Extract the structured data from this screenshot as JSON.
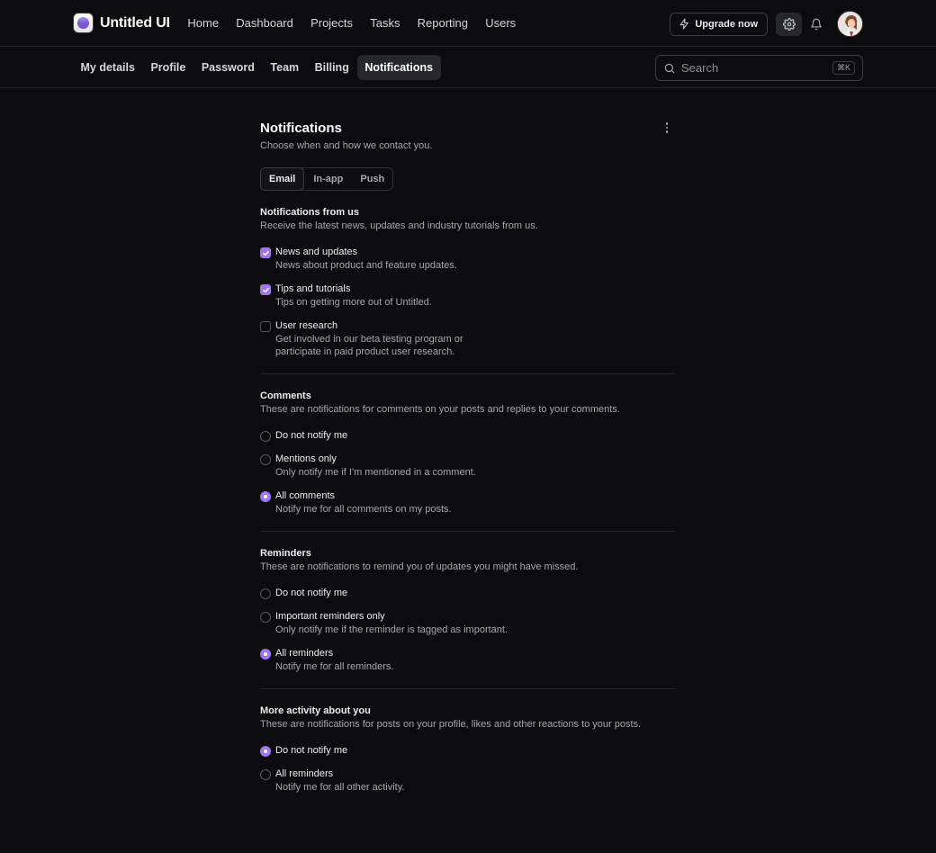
{
  "brand": {
    "name": "Untitled UI"
  },
  "main_nav": [
    "Home",
    "Dashboard",
    "Projects",
    "Tasks",
    "Reporting",
    "Users"
  ],
  "top_actions": {
    "upgrade_label": "Upgrade now",
    "upgrade_icon": "lightning-icon",
    "settings_icon": "gear-icon",
    "notifications_icon": "bell-icon"
  },
  "sub_nav": {
    "items": [
      "My details",
      "Profile",
      "Password",
      "Team",
      "Billing",
      "Notifications"
    ],
    "active": "Notifications"
  },
  "search": {
    "placeholder": "Search",
    "shortcut": "⌘K"
  },
  "page": {
    "title": "Notifications",
    "subtitle": "Choose when and how we contact you."
  },
  "tabs": {
    "items": [
      "Email",
      "In-app",
      "Push"
    ],
    "active": "Email"
  },
  "sections": {
    "from_us": {
      "title": "Notifications from us",
      "desc": "Receive the latest news, updates and industry tutorials from us.",
      "options": [
        {
          "label": "News and updates",
          "help": "News about product and feature updates.",
          "checked": true
        },
        {
          "label": "Tips and tutorials",
          "help": "Tips on getting more out of Untitled.",
          "checked": true
        },
        {
          "label": "User research",
          "help": "Get involved in our beta testing program or",
          "help2": "participate in paid product user research.",
          "checked": false
        }
      ]
    },
    "comments": {
      "title": "Comments",
      "desc": "These are notifications for comments on your posts and replies to your comments.",
      "options": [
        {
          "label": "Do not notify me",
          "help": "",
          "selected": false
        },
        {
          "label": "Mentions only",
          "help": "Only notify me if I'm mentioned in a comment.",
          "selected": false
        },
        {
          "label": "All comments",
          "help": "Notify me for all comments on my posts.",
          "selected": true
        }
      ]
    },
    "reminders": {
      "title": "Reminders",
      "desc": "These are notifications to remind you of updates you might have missed.",
      "options": [
        {
          "label": "Do not notify me",
          "help": "",
          "selected": false
        },
        {
          "label": "Important reminders only",
          "help": "Only notify me if the reminder is tagged as important.",
          "selected": false
        },
        {
          "label": "All reminders",
          "help": "Notify me for all reminders.",
          "selected": true
        }
      ]
    },
    "activity": {
      "title": "More activity about you",
      "desc": "These are notifications for posts on your profile, likes and other reactions to your posts.",
      "options": [
        {
          "label": "Do not notify me",
          "help": "",
          "selected": true
        },
        {
          "label": "All reminders",
          "help": "Notify me for all other activity.",
          "selected": false
        }
      ]
    }
  },
  "colors": {
    "accent": "#9e77ed",
    "background": "#0c0c0e",
    "border": "#26272b"
  }
}
